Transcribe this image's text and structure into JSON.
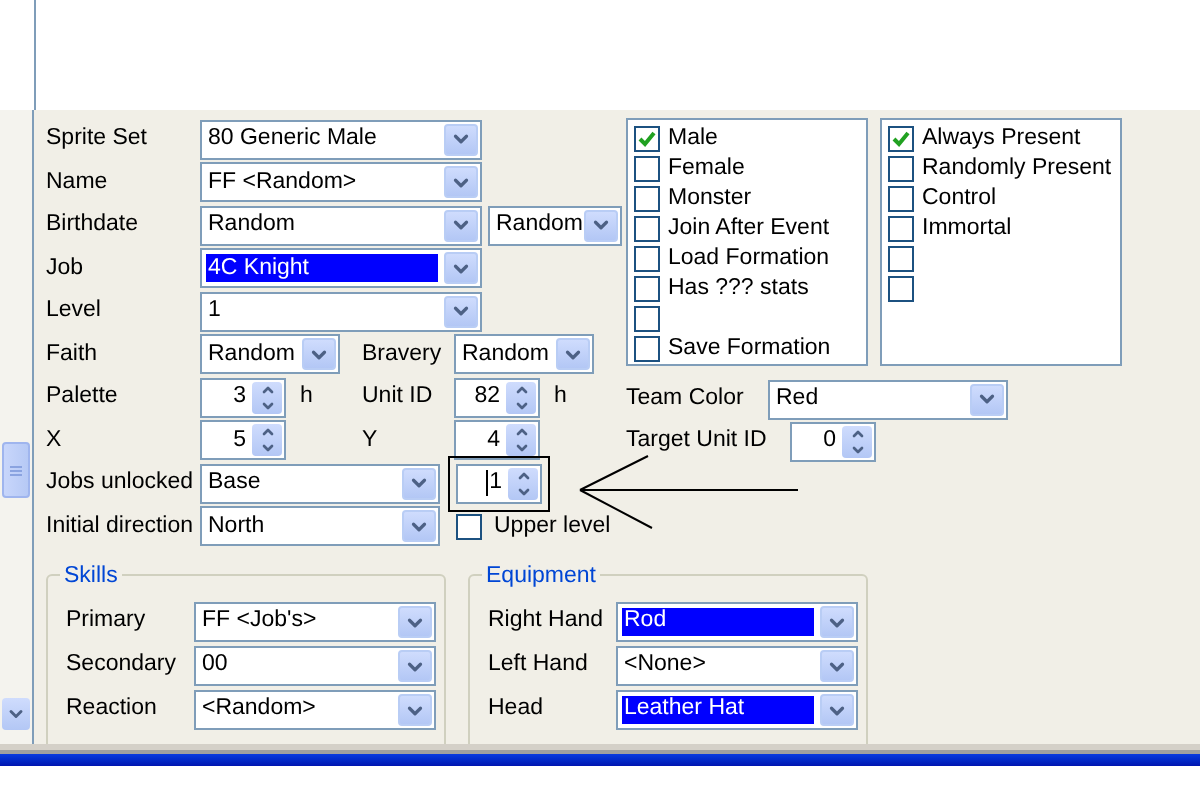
{
  "rows": [
    {
      "label": "Sprite Set",
      "control": {
        "kind": "combo",
        "value": "80 Generic Male",
        "highlighted": false
      }
    },
    {
      "label": "Name",
      "control": {
        "kind": "combo",
        "value": "FF <Random>",
        "highlighted": false
      }
    },
    {
      "label": "Birthdate",
      "control": {
        "kind": "combo",
        "value": "Random",
        "highlighted": false
      },
      "second": {
        "control": {
          "kind": "combo",
          "value": "Random",
          "highlighted": false
        }
      }
    },
    {
      "label": "Job",
      "control": {
        "kind": "combo",
        "value": "4C Knight",
        "highlighted": true
      }
    },
    {
      "label": "Level",
      "control": {
        "kind": "combo",
        "value": "1",
        "highlighted": false
      }
    },
    {
      "label": "Faith",
      "control": {
        "kind": "combo",
        "value": "Random",
        "highlighted": false
      },
      "second": {
        "label": "Bravery",
        "control": {
          "kind": "combo",
          "value": "Random",
          "highlighted": false
        }
      }
    },
    {
      "label": "Palette",
      "control": {
        "kind": "spin",
        "value": "3",
        "unit": "h"
      },
      "second": {
        "label": "Unit ID",
        "control": {
          "kind": "spin",
          "value": "82",
          "unit": "h"
        }
      }
    },
    {
      "label": "X",
      "control": {
        "kind": "spin",
        "value": "5"
      },
      "second": {
        "label": "Y",
        "control": {
          "kind": "spin",
          "value": "4"
        }
      }
    },
    {
      "label": "Jobs unlocked",
      "control": {
        "kind": "combo",
        "value": "Base",
        "highlighted": false
      },
      "second": {
        "control": {
          "kind": "spin",
          "value": "1",
          "focused": true,
          "framed": true
        }
      }
    },
    {
      "label": "Initial direction",
      "control": {
        "kind": "combo",
        "value": "North",
        "highlighted": false
      },
      "second": {
        "control": {
          "kind": "checkbox",
          "label": "Upper level",
          "checked": false
        }
      }
    }
  ],
  "flags_left": [
    {
      "label": "Male",
      "checked": true
    },
    {
      "label": "Female",
      "checked": false
    },
    {
      "label": "Monster",
      "checked": false
    },
    {
      "label": "Join After Event",
      "checked": false
    },
    {
      "label": "Load Formation",
      "checked": false
    },
    {
      "label": "Has ??? stats",
      "checked": false
    },
    {
      "checked": false
    },
    {
      "label": "Save Formation",
      "checked": false
    }
  ],
  "flags_right": [
    {
      "label": "Always Present",
      "checked": true
    },
    {
      "label": "Randomly Present",
      "checked": false
    },
    {
      "label": "Control",
      "checked": false
    },
    {
      "label": "Immortal",
      "checked": false
    },
    {
      "checked": false
    },
    {
      "checked": false
    }
  ],
  "team_color": {
    "label": "Team Color",
    "value": "Red"
  },
  "target_unit": {
    "label": "Target Unit ID",
    "value": "0"
  },
  "groups": [
    {
      "title": "Skills",
      "rows": [
        {
          "label": "Primary",
          "value": "FF <Job's>",
          "highlighted": false
        },
        {
          "label": "Secondary",
          "value": "00",
          "highlighted": false
        },
        {
          "label": "Reaction",
          "value": "<Random>",
          "highlighted": false
        }
      ]
    },
    {
      "title": "Equipment",
      "rows": [
        {
          "label": "Right Hand",
          "value": "Rod",
          "highlighted": true
        },
        {
          "label": "Left Hand",
          "value": "<None>",
          "highlighted": false
        },
        {
          "label": "Head",
          "value": "Leather Hat",
          "highlighted": true
        }
      ]
    }
  ]
}
